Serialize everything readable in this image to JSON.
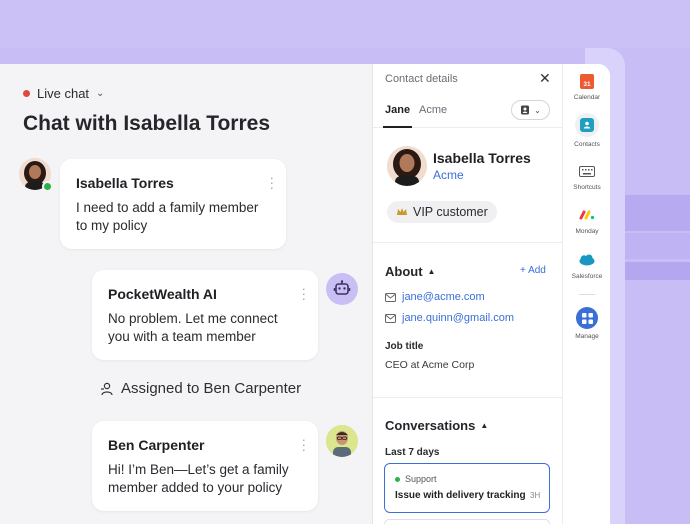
{
  "chat": {
    "channel_label": "Live chat",
    "title": "Chat with Isabella Torres",
    "messages": [
      {
        "sender": "Isabella Torres",
        "text": "I need to add a family member to my policy"
      },
      {
        "sender": "PocketWealth AI",
        "text": "No problem. Let me connect you with a team member"
      },
      {
        "sender": "Ben Carpenter",
        "text": "Hi! I’m Ben—Let’s get a family member added to your policy"
      }
    ],
    "assignment": "Assigned to Ben Carpenter"
  },
  "details": {
    "header": "Contact details",
    "tabs": [
      "Jane",
      "Acme"
    ],
    "contact": {
      "name": "Isabella Torres",
      "company": "Acme",
      "tag": "VIP customer"
    },
    "about": {
      "title": "About",
      "add_label": "+ Add",
      "emails": [
        "jane@acme.com",
        "jane.quinn@gmail.com"
      ],
      "job_title_label": "Job title",
      "job_title_value": "CEO at Acme Corp"
    },
    "conversations": {
      "title": "Conversations",
      "period": "Last 7 days",
      "items": [
        {
          "status": "Support",
          "title": "Issue with delivery tracking",
          "time": "3H"
        }
      ]
    }
  },
  "rail": {
    "calendar_day": "31",
    "items": [
      "Calendar",
      "Contacts",
      "Shortcuts",
      "Monday",
      "Salesforce",
      "Manage"
    ]
  },
  "colors": {
    "accent": "#3a6fd6",
    "online": "#2cb14a",
    "live": "#e0493d",
    "background": "#c8bef5"
  }
}
